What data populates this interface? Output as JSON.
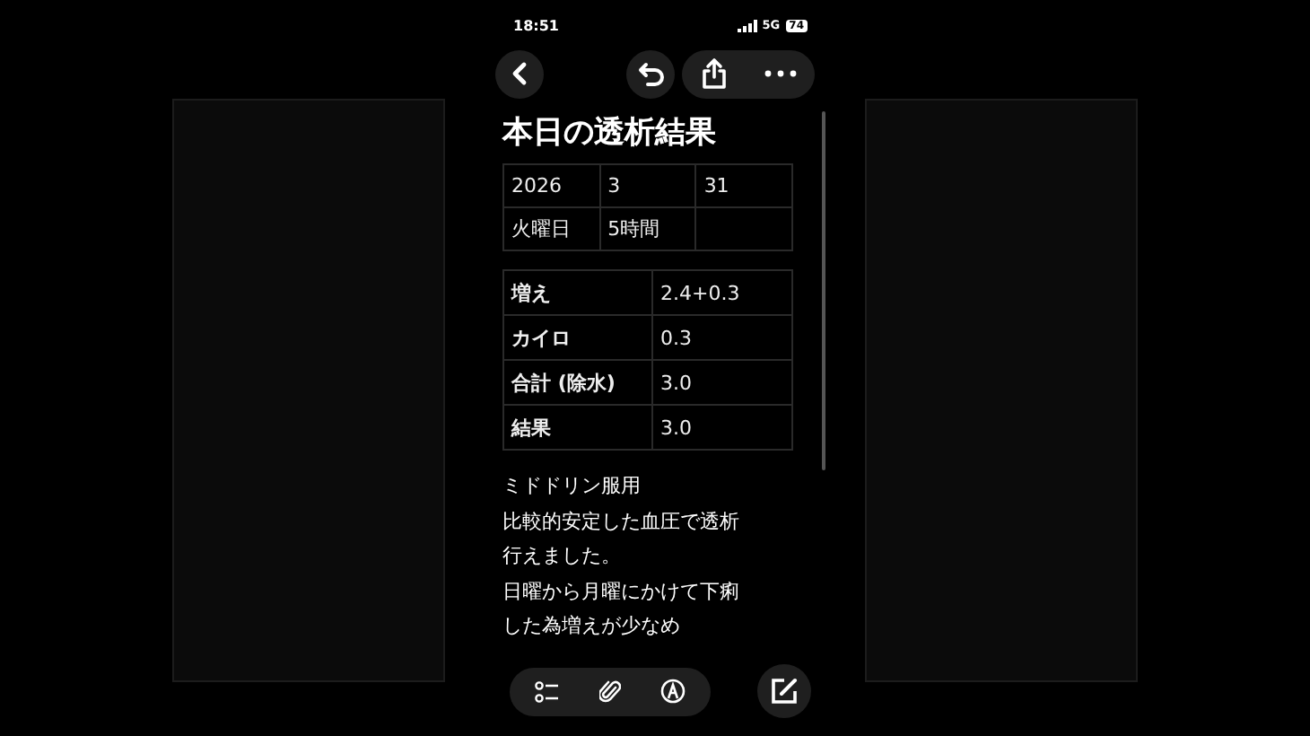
{
  "status_bar": {
    "time": "18:51",
    "network": "5G",
    "battery": "74"
  },
  "title": "本日の透析結果",
  "date_table": {
    "rows": [
      [
        "2026",
        "3",
        "31"
      ],
      [
        "火曜日",
        "5時間"
      ]
    ]
  },
  "result_table": {
    "rows": [
      [
        "増え",
        "2.4+0.3"
      ],
      [
        "カイロ",
        "0.3"
      ],
      [
        "合計 (除水)",
        "3.0"
      ],
      [
        "結果",
        "3.0"
      ]
    ]
  },
  "note_lines": [
    "ミドドリン服用",
    "比較的安定した血圧で透析",
    "行えました。",
    "日曜から月曜にかけて下痢",
    "した為増えが少なめ"
  ]
}
